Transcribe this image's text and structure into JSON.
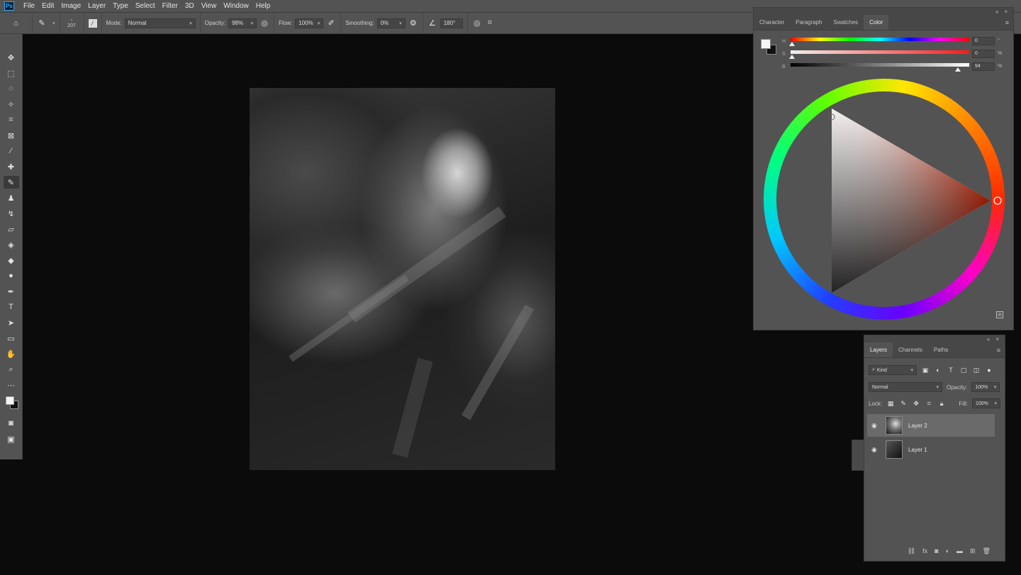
{
  "app": {
    "logo": "Ps",
    "menu": [
      "File",
      "Edit",
      "Image",
      "Layer",
      "Type",
      "Select",
      "Filter",
      "3D",
      "View",
      "Window",
      "Help"
    ]
  },
  "options_bar": {
    "brush_size_top": "↑",
    "brush_size": "207",
    "mode_label": "Mode:",
    "mode_value": "Normal",
    "opacity_label": "Opacity:",
    "opacity_value": "98%",
    "flow_label": "Flow:",
    "flow_value": "100%",
    "smoothing_label": "Smoothing:",
    "smoothing_value": "0%",
    "angle_value": "180°"
  },
  "color_panel": {
    "tabs": [
      "Character",
      "Paragraph",
      "Swatches",
      "Color"
    ],
    "active_tab": "Color",
    "sliders": [
      {
        "letter": "H",
        "value": "0",
        "unit": "°"
      },
      {
        "letter": "S",
        "value": "0",
        "unit": "%"
      },
      {
        "letter": "B",
        "value": "94",
        "unit": "%"
      }
    ],
    "foreground_color": "#f5f5f5",
    "background_color": "#111111",
    "hue_selected": "#ff2a00"
  },
  "layers_panel": {
    "tabs": [
      "Layers",
      "Channels",
      "Paths"
    ],
    "active_tab": "Layers",
    "filter_kind": "Kind",
    "blend_mode": "Normal",
    "opacity_label": "Opacity:",
    "opacity_value": "100%",
    "lock_label": "Lock:",
    "fill_label": "Fill:",
    "fill_value": "100%",
    "layers": [
      {
        "name": "Layer 2",
        "selected": true
      },
      {
        "name": "Layer 1",
        "selected": false
      }
    ],
    "bottom_icons": [
      "link-icon",
      "fx-icon",
      "mask-icon",
      "adjustment-icon",
      "folder-icon",
      "new-layer-icon",
      "trash-icon"
    ]
  }
}
